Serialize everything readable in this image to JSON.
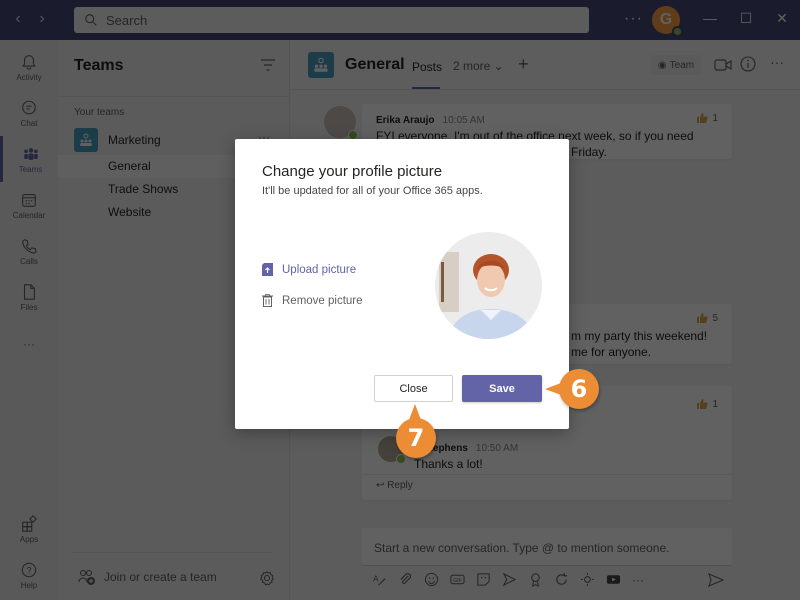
{
  "titlebar": {
    "search_placeholder": "Search",
    "more_label": "···",
    "avatar_initial": "G",
    "minimize": "—",
    "maximize": "☐",
    "close": "✕"
  },
  "rail": {
    "items": [
      {
        "label": "Activity",
        "icon": "bell-icon"
      },
      {
        "label": "Chat",
        "icon": "chat-icon"
      },
      {
        "label": "Teams",
        "icon": "teams-icon",
        "active": true
      },
      {
        "label": "Calendar",
        "icon": "calendar-icon"
      },
      {
        "label": "Calls",
        "icon": "phone-icon"
      },
      {
        "label": "Files",
        "icon": "file-icon"
      },
      {
        "label": "···",
        "icon": "more-icon"
      },
      {
        "label": "Apps",
        "icon": "apps-icon"
      },
      {
        "label": "Help",
        "icon": "help-icon"
      }
    ]
  },
  "teams_panel": {
    "title": "Teams",
    "section_label": "Your teams",
    "team_name": "Marketing",
    "team_more": "···",
    "channels": [
      "General",
      "Trade Shows",
      "Website"
    ],
    "active_channel": "General",
    "join_label": "Join or create a team"
  },
  "channel_header": {
    "title": "General",
    "tab_posts": "Posts",
    "tab_more": "2 more ⌄",
    "add": "+",
    "team_button": "Team",
    "more": "···"
  },
  "messages": [
    {
      "author": "Erika Araujo",
      "time": "10:05 AM",
      "text_line1": "FYI everyone, I'm out of the office next week, so if you need",
      "text_line2": "Friday.",
      "likes": "1"
    },
    {
      "text_line1": "m my party this weekend!",
      "text_line2": "me for anyone.",
      "likes": "5"
    },
    {
      "likes": "1"
    },
    {
      "author": "d Stephens",
      "time": "10:50 AM",
      "text": "Thanks a lot!"
    }
  ],
  "reply_label": "Reply",
  "compose": {
    "placeholder": "Start a new conversation. Type @ to mention someone."
  },
  "dialog": {
    "title": "Change your profile picture",
    "subtitle": "It'll be updated for all of your Office 365 apps.",
    "upload_label": "Upload picture",
    "remove_label": "Remove picture",
    "close_label": "Close",
    "save_label": "Save"
  },
  "callouts": {
    "save_step": "6",
    "close_step": "7"
  },
  "colors": {
    "brand": "#6264a7",
    "titlebar": "#464775",
    "callout": "#ec8c34",
    "presence": "#92c353"
  }
}
